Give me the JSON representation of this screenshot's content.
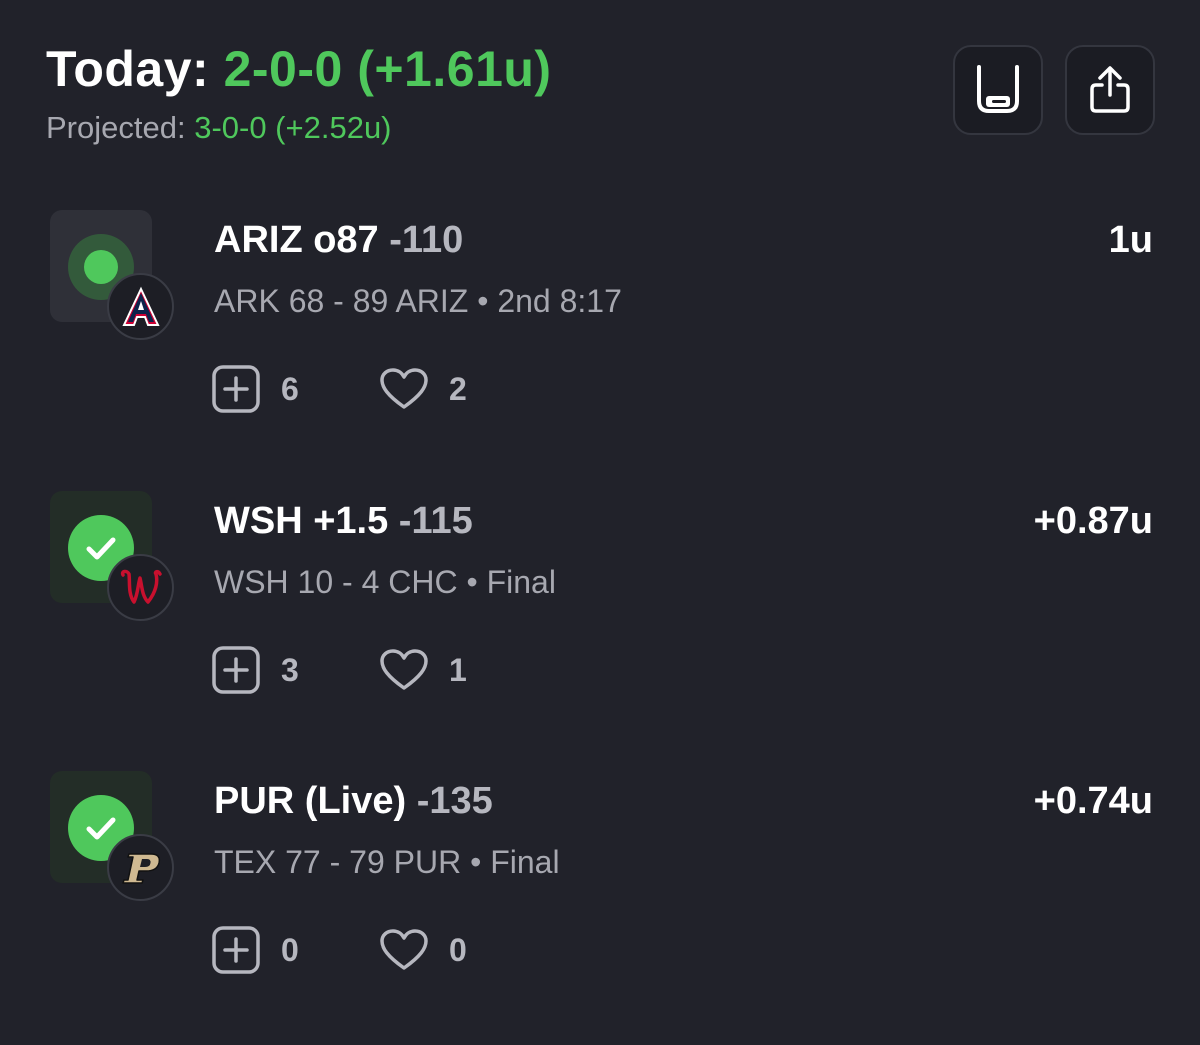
{
  "summary": {
    "today_label": "Today:",
    "today_value": "2-0-0 (+1.61u)",
    "projected_label": "Projected:",
    "projected_value": "3-0-0 (+2.52u)"
  },
  "header_actions": [
    {
      "icon": "cup-icon"
    },
    {
      "icon": "share-icon"
    }
  ],
  "colors": {
    "background": "#21222a",
    "accent_green": "#4fc85c",
    "muted_text": "#a7a8b0"
  },
  "bets": [
    {
      "pick": "ARIZ o87",
      "odds": "-110",
      "units": "1u",
      "score": "ARK 68 - 89 ARIZ",
      "separator": "•",
      "status_text": "2nd 8:17",
      "status": "live",
      "team_logo": "arizona-logo-icon",
      "tails": "6",
      "likes": "2"
    },
    {
      "pick": "WSH +1.5",
      "odds": "-115",
      "units": "+0.87u",
      "score": "WSH 10 - 4 CHC",
      "separator": "•",
      "status_text": "Final",
      "status": "won",
      "team_logo": "nationals-logo-icon",
      "tails": "3",
      "likes": "1"
    },
    {
      "pick": "PUR (Live)",
      "odds": "-135",
      "units": "+0.74u",
      "score": "TEX 77 - 79 PUR",
      "separator": "•",
      "status_text": "Final",
      "status": "won",
      "team_logo": "purdue-logo-icon",
      "tails": "0",
      "likes": "0"
    }
  ]
}
